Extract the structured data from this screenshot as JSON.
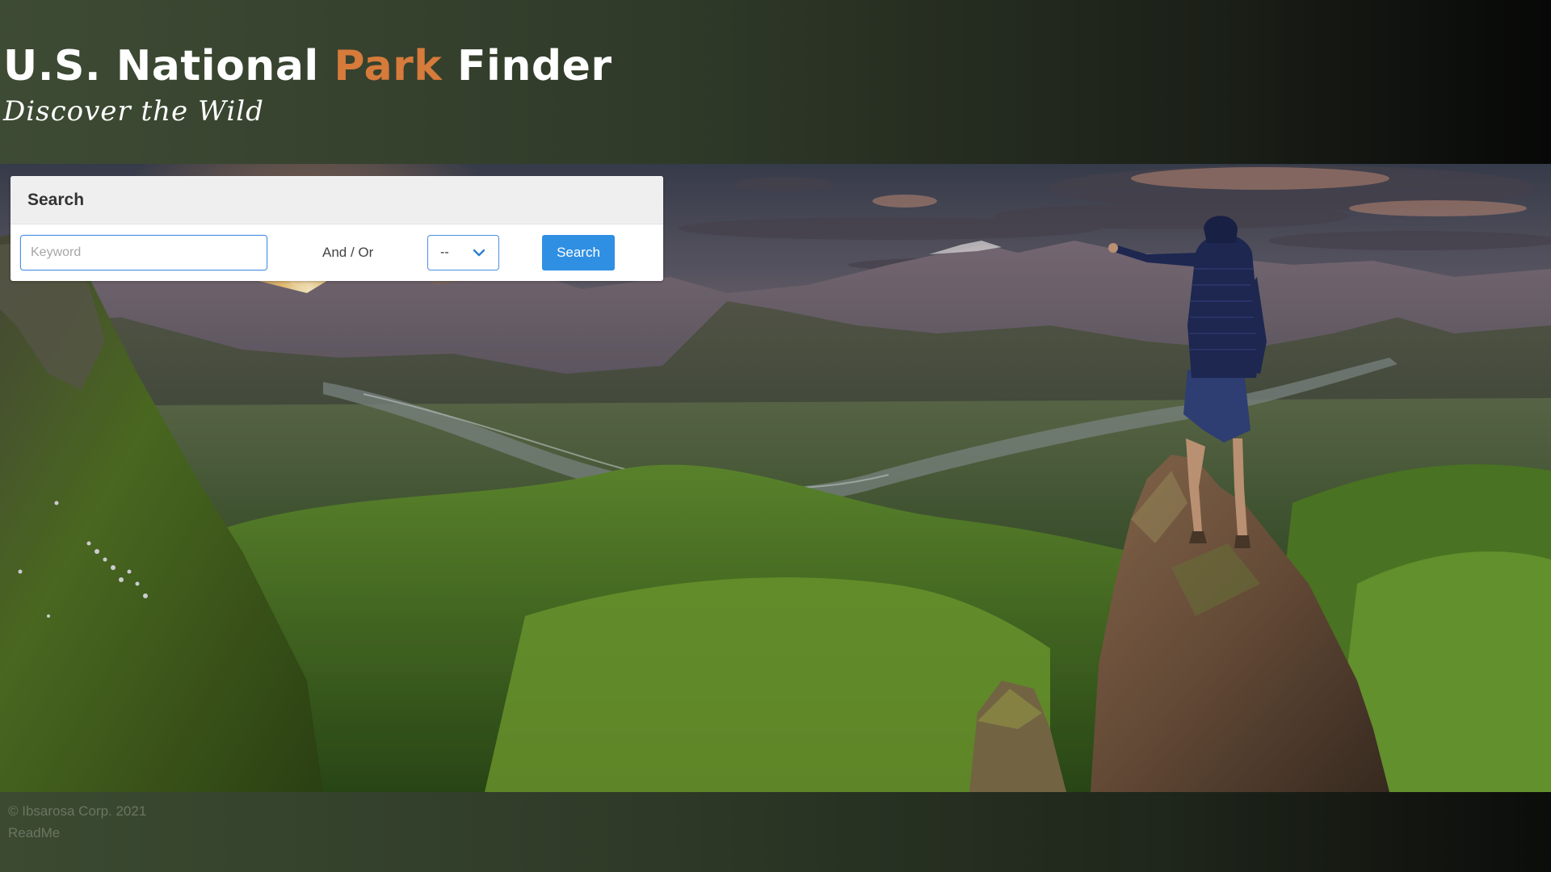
{
  "header": {
    "title_part1": "U.S. National ",
    "title_accent": "Park",
    "title_part2": " Finder",
    "subtitle": "Discover the Wild",
    "accent_color": "#d67b3b"
  },
  "search": {
    "heading": "Search",
    "keyword_placeholder": "Keyword",
    "keyword_value": "",
    "conjunction_label": "And / Or",
    "select_value": "--",
    "button_label": "Search",
    "button_color": "#2f8fe3"
  },
  "footer": {
    "copyright": "© Ibsarosa Corp. 2021",
    "readme_link": "ReadMe"
  }
}
